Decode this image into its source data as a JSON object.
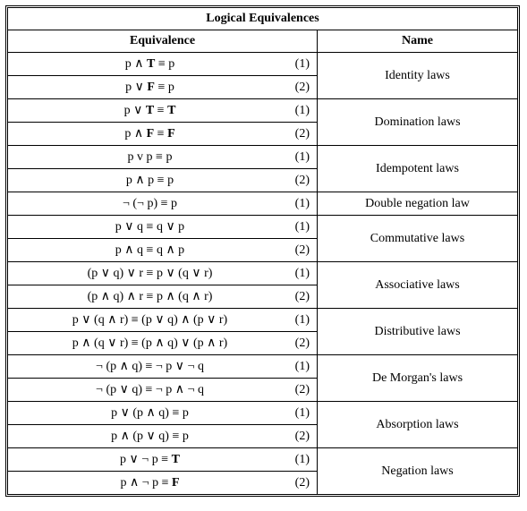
{
  "title": "Logical Equivalences",
  "headers": {
    "equivalence": "Equivalence",
    "name": "Name"
  },
  "laws": [
    {
      "name": "Identity laws",
      "rows": [
        {
          "tokens": [
            "p ∧ ",
            {
              "b": "T"
            },
            " ≡ p"
          ],
          "num": "(1)"
        },
        {
          "tokens": [
            "p ∨ ",
            {
              "b": "F"
            },
            " ≡ p"
          ],
          "num": "(2)"
        }
      ]
    },
    {
      "name": "Domination laws",
      "rows": [
        {
          "tokens": [
            "p ∨ ",
            {
              "b": "T"
            },
            " ≡ ",
            {
              "b": "T"
            }
          ],
          "num": "(1)"
        },
        {
          "tokens": [
            "p ∧ ",
            {
              "b": "F"
            },
            " ≡ ",
            {
              "b": "F"
            }
          ],
          "num": "(2)"
        }
      ]
    },
    {
      "name": "Idempotent laws",
      "rows": [
        {
          "tokens": [
            "p v p ≡ p"
          ],
          "num": "(1)"
        },
        {
          "tokens": [
            "p ∧ p ≡ p"
          ],
          "num": "(2)"
        }
      ]
    },
    {
      "name": "Double negation law",
      "rows": [
        {
          "tokens": [
            "¬ (¬ p) ≡ p"
          ],
          "num": "(1)"
        }
      ]
    },
    {
      "name": "Commutative laws",
      "rows": [
        {
          "tokens": [
            "p ∨ q ≡ q ∨ p"
          ],
          "num": "(1)"
        },
        {
          "tokens": [
            "p ∧ q ≡ q ∧ p"
          ],
          "num": "(2)"
        }
      ]
    },
    {
      "name": "Associative laws",
      "rows": [
        {
          "tokens": [
            "(p ∨ q) ∨ r ≡ p ∨ (q ∨ r)"
          ],
          "num": "(1)"
        },
        {
          "tokens": [
            "(p ∧ q) ∧ r ≡ p ∧ (q ∧ r)"
          ],
          "num": "(2)"
        }
      ]
    },
    {
      "name": "Distributive laws",
      "rows": [
        {
          "tokens": [
            "p ∨ (q ∧ r) ≡ (p ∨ q) ∧ (p ∨ r)"
          ],
          "num": "(1)"
        },
        {
          "tokens": [
            "p ∧ (q ∨ r) ≡ (p ∧ q) ∨ (p ∧ r)"
          ],
          "num": "(2)"
        }
      ]
    },
    {
      "name": "De Morgan's laws",
      "rows": [
        {
          "tokens": [
            "¬ (p ∧ q) ≡ ¬ p ∨ ¬ q"
          ],
          "num": "(1)"
        },
        {
          "tokens": [
            "¬ (p ∨ q) ≡ ¬ p ∧ ¬ q"
          ],
          "num": "(2)"
        }
      ]
    },
    {
      "name": "Absorption laws",
      "rows": [
        {
          "tokens": [
            "p ∨ (p ∧ q) ≡ p"
          ],
          "num": "(1)"
        },
        {
          "tokens": [
            "p ∧ (p ∨ q) ≡ p"
          ],
          "num": "(2)"
        }
      ]
    },
    {
      "name": "Negation laws",
      "rows": [
        {
          "tokens": [
            "p ∨ ¬ p ≡ ",
            {
              "b": "T"
            }
          ],
          "num": "(1)"
        },
        {
          "tokens": [
            "p ∧ ¬ p ≡ ",
            {
              "b": "F"
            }
          ],
          "num": "(2)"
        }
      ]
    }
  ]
}
